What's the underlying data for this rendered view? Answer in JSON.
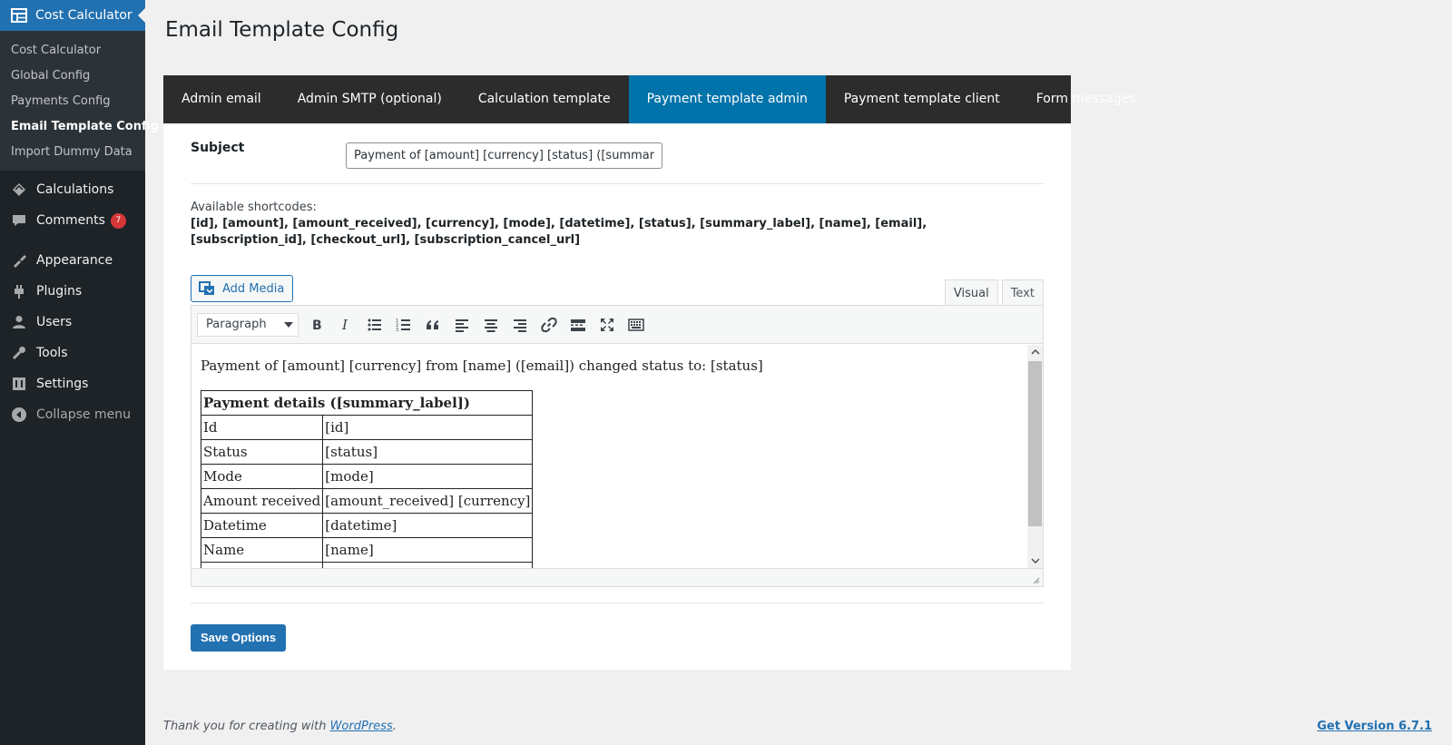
{
  "sidebar": {
    "current": {
      "label": "Cost Calculator",
      "icon": "table-calc-icon"
    },
    "submenu": [
      {
        "label": "Cost Calculator",
        "active": false
      },
      {
        "label": "Global Config",
        "active": false
      },
      {
        "label": "Payments Config",
        "active": false
      },
      {
        "label": "Email Template Config",
        "active": true
      },
      {
        "label": "Import Dummy Data",
        "active": false
      }
    ],
    "menu": [
      {
        "label": "Calculations",
        "icon": "calculations-icon"
      },
      {
        "label": "Comments",
        "icon": "comments-icon",
        "badge": "7"
      },
      {
        "label": "Appearance",
        "icon": "appearance-icon"
      },
      {
        "label": "Plugins",
        "icon": "plugins-icon"
      },
      {
        "label": "Users",
        "icon": "users-icon"
      },
      {
        "label": "Tools",
        "icon": "tools-icon"
      },
      {
        "label": "Settings",
        "icon": "settings-icon"
      },
      {
        "label": "Collapse menu",
        "icon": "collapse-icon"
      }
    ]
  },
  "page": {
    "title": "Email Template Config"
  },
  "tabs": [
    {
      "label": "Admin email",
      "active": false
    },
    {
      "label": "Admin SMTP (optional)",
      "active": false
    },
    {
      "label": "Calculation template",
      "active": false
    },
    {
      "label": "Payment template admin",
      "active": true
    },
    {
      "label": "Payment template client",
      "active": false
    },
    {
      "label": "Form messages",
      "active": false
    }
  ],
  "subject": {
    "label": "Subject",
    "value": "Payment of [amount] [currency] [status] ([summary_label])"
  },
  "shortcodes": {
    "label": "Available shortcodes:",
    "codes": "[id], [amount], [amount_received], [currency], [mode], [datetime], [status], [summary_label], [name], [email], [subscription_id], [checkout_url], [subscription_cancel_url]"
  },
  "editor": {
    "add_media": "Add Media",
    "mode_visual": "Visual",
    "mode_text": "Text",
    "format": "Paragraph",
    "intro": "Payment of [amount] [currency] from [name] ([email]) changed status to: [status]",
    "table_header": "Payment details ([summary_label])",
    "table_rows": [
      {
        "key": "Id",
        "value": "[id]"
      },
      {
        "key": "Status",
        "value": "[status]"
      },
      {
        "key": "Mode",
        "value": "[mode]"
      },
      {
        "key": "Amount received",
        "value": "[amount_received] [currency]"
      },
      {
        "key": "Datetime",
        "value": "[datetime]"
      },
      {
        "key": "Name",
        "value": "[name]"
      },
      {
        "key": "",
        "value": ""
      }
    ]
  },
  "save_button": "Save Options",
  "footer": {
    "thanks_prefix": "Thank you for creating with ",
    "wordpress_link": "WordPress",
    "thanks_suffix": ".",
    "version": "Get Version 6.7.1"
  },
  "colors": {
    "sidebar_bg": "#1d2327",
    "accent": "#2271b1",
    "active_tab": "#0073aa",
    "tabs_bg": "#2c2c2c",
    "badge": "#d63638"
  }
}
